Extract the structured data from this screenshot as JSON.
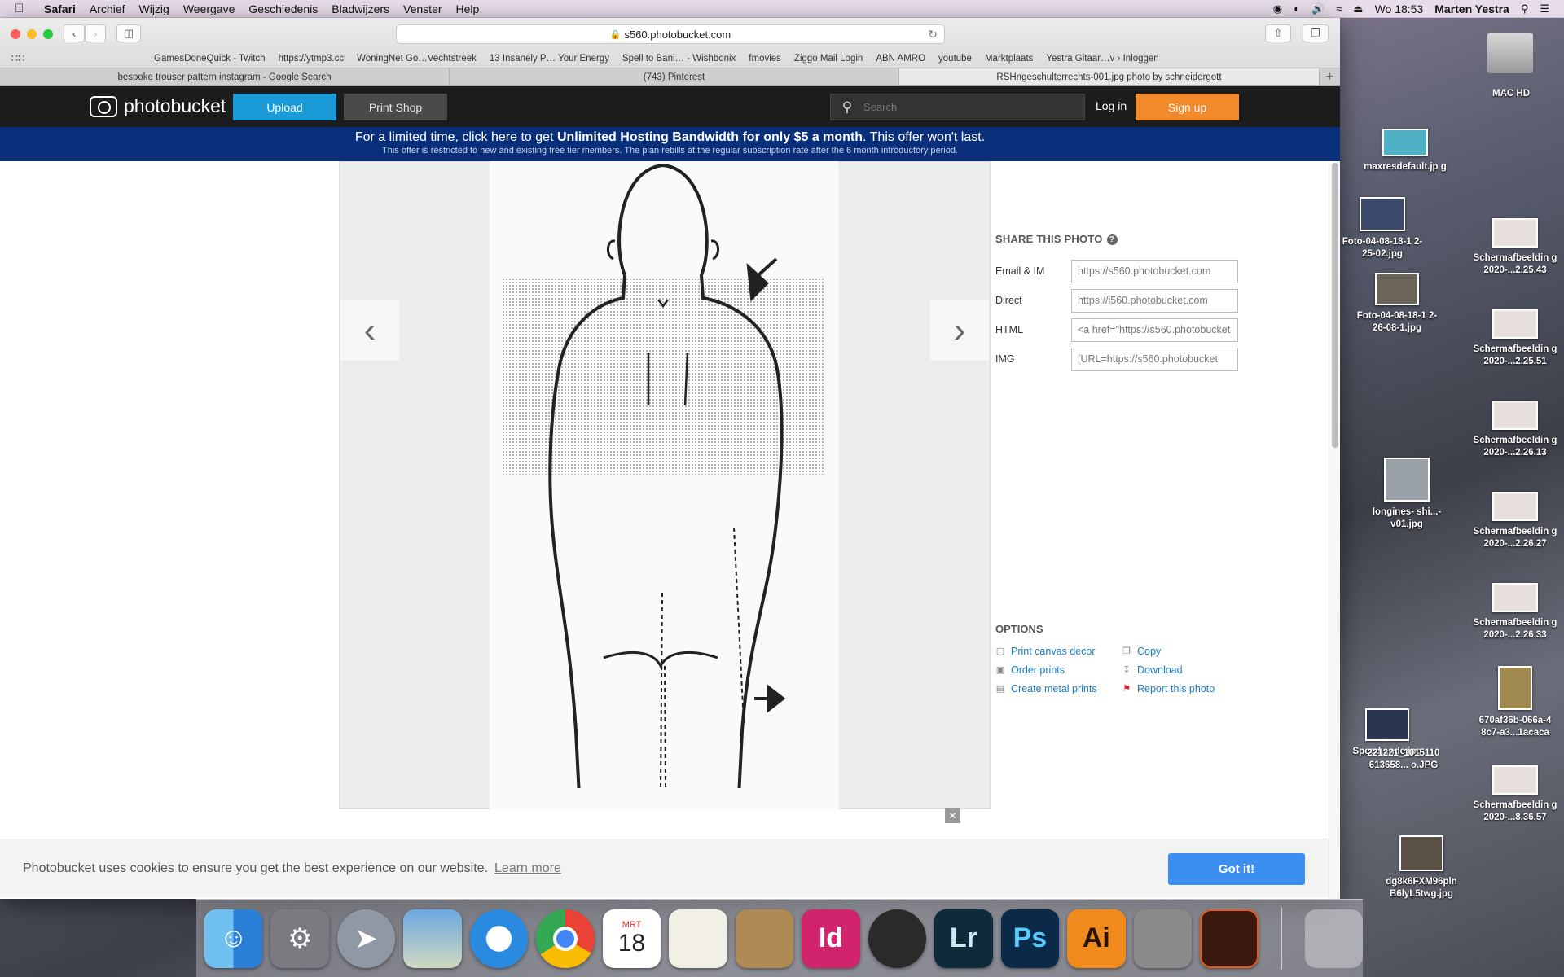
{
  "menubar": {
    "app": "Safari",
    "items": [
      "Archief",
      "Wijzig",
      "Weergave",
      "Geschiedenis",
      "Bladwijzers",
      "Venster",
      "Help"
    ],
    "clock": "Wo 18:53",
    "user": "Marten Yestra"
  },
  "browser": {
    "address": "s560.photobucket.com",
    "bookmarks": [
      "GamesDoneQuick - Twitch",
      "https://ytmp3.cc",
      "WoningNet Go…Vechtstreek",
      "13 Insanely P… Your Energy",
      "Spell to Bani… - Wishbonix",
      "fmovies",
      "Ziggo Mail Login",
      "ABN AMRO",
      "youtube",
      "Marktplaats",
      "Yestra Gitaar…v › Inloggen"
    ],
    "tabs": [
      "bespoke trouser pattern instagram - Google Search",
      "(743) Pinterest",
      "RSHngeschulterrechts-001.jpg photo by schneidergott"
    ]
  },
  "header": {
    "logo": "photobucket",
    "upload": "Upload",
    "print_shop": "Print Shop",
    "search_placeholder": "Search",
    "login": "Log in",
    "signup": "Sign up"
  },
  "promo": {
    "pre": "For a limited time, click here to get ",
    "bold": "Unlimited Hosting Bandwidth for only $5 a month",
    "post": ". This offer won't last.",
    "fine": "This offer is restricted to new and existing free tier members. The plan rebills at the regular subscription rate after the 6 month introductory period."
  },
  "share": {
    "title": "SHARE THIS PHOTO",
    "rows": [
      {
        "label": "Email & IM",
        "value": "https://s560.photobucket.com"
      },
      {
        "label": "Direct",
        "value": "https://i560.photobucket.com"
      },
      {
        "label": "HTML",
        "value": "<a href=\"https://s560.photobucket"
      },
      {
        "label": "IMG",
        "value": "[URL=https://s560.photobucket"
      }
    ]
  },
  "options": {
    "title": "OPTIONS",
    "left": [
      "Print canvas decor",
      "Order prints",
      "Create metal prints"
    ],
    "right": [
      "Copy",
      "Download",
      "Report this photo"
    ]
  },
  "cookie": {
    "message": "Photobucket uses cookies to ensure you get the best experience on our website.",
    "learn_more": "Learn more",
    "accept": "Got it!"
  },
  "desktop": {
    "drive": "MAC HD",
    "icons": [
      "maxresdefault.jp g",
      "Foto-04-08-18-1 2-25-02.jpg",
      "Foto-04-08-18-1 2-26-08-1.jpg",
      "longines- shi...-v01.jpg",
      "Speed...nde.jpg",
      "221221_1015110 613658... o.JPG",
      "dg8k6FXM96pln B6lyL5twg.jpg",
      "670af36b-066a-4 8c7-a3...1acaca",
      "Schermafbeeldin g 2020-...2.25.43",
      "Schermafbeeldin g 2020-...2.25.51",
      "Schermafbeeldin g 2020-...2.26.13",
      "Schermafbeeldin g 2020-...2.26.27",
      "Schermafbeeldin g 2020-...2.26.33",
      "Schermafbeeldin g 2020-...8.36.57"
    ]
  },
  "dock": {
    "calendar_month": "MRT",
    "calendar_day": "18"
  }
}
